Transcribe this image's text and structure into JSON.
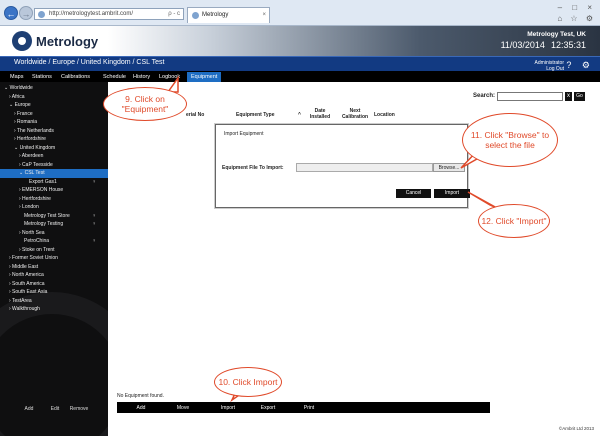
{
  "browser": {
    "url": "http://metrologytest.ambrit.com/",
    "tab_title": "Metrology",
    "addr_tools": "ρ - c",
    "tab_close": "×",
    "window_controls": "–  □  ×",
    "toolbar_icons": "⌂ ☆ ⚙"
  },
  "app": {
    "logo": "Metrology",
    "site_name": "Metrology Test, UK",
    "date": "11/03/2014",
    "time": "12:35:31",
    "breadcrumb": "Worldwide / Europe / United Kingdom / CSL Test",
    "user": "Administrator",
    "logout": "Log Out"
  },
  "menu": {
    "items": [
      "Maps",
      "Stations",
      "Calibrations",
      "Schedule",
      "History",
      "Logbook",
      "Equipment"
    ],
    "active": "Equipment",
    "icons": "? ⚙"
  },
  "sidebar": {
    "tree": [
      {
        "label": "⌄ Worldwide",
        "indent": 0
      },
      {
        "label": "› Africa",
        "indent": 1
      },
      {
        "label": "⌄ Europe",
        "indent": 1
      },
      {
        "label": "› France",
        "indent": 2
      },
      {
        "label": "› Romania",
        "indent": 2
      },
      {
        "label": "› The Netherlands",
        "indent": 2
      },
      {
        "label": "› Hertfordshire",
        "indent": 2
      },
      {
        "label": "⌄ United Kingdom",
        "indent": 2
      },
      {
        "label": "› Aberdeen",
        "indent": 3
      },
      {
        "label": "› CaP Teesside",
        "indent": 3
      },
      {
        "label": "⌄ CSL Test",
        "indent": 3,
        "selected": true
      },
      {
        "label": "Export Gas1",
        "indent": 5,
        "star": "♆"
      },
      {
        "label": "› EMERSON House",
        "indent": 3
      },
      {
        "label": "› Hertfordshire",
        "indent": 3
      },
      {
        "label": "› London",
        "indent": 3
      },
      {
        "label": "Metrology Test Store",
        "indent": 4,
        "star": "♆"
      },
      {
        "label": "Metrology Testing",
        "indent": 4,
        "star": "♆"
      },
      {
        "label": "› North Sea",
        "indent": 3
      },
      {
        "label": "PetroChina",
        "indent": 4,
        "star": "♆"
      },
      {
        "label": "› Stoke on Trent",
        "indent": 3
      },
      {
        "label": "› Former Soviet Union",
        "indent": 1
      },
      {
        "label": "› Middle East",
        "indent": 1
      },
      {
        "label": "› North America",
        "indent": 1
      },
      {
        "label": "› South America",
        "indent": 1
      },
      {
        "label": "› South East Asia",
        "indent": 1
      },
      {
        "label": "› TestArea",
        "indent": 1
      },
      {
        "label": "› Walkthrough",
        "indent": 1
      }
    ],
    "buttons": [
      "Add",
      "Edit",
      "Remove"
    ]
  },
  "main": {
    "search_label": "Search:",
    "search_value": "",
    "search_clear": "x",
    "search_go": "Go",
    "columns": [
      "erial No",
      "Equipment Type",
      "^",
      "Date Installed",
      "Next Calibration",
      "Location"
    ],
    "dialog": {
      "title": "Import Equipment",
      "file_label": "Equipment File To Import:",
      "file_value": "",
      "browse": "Browse...",
      "cancel": "Cancel",
      "import": "Import"
    },
    "empty_text": "No Equipment found.",
    "bottom_buttons": [
      "Add",
      "Move",
      "Import",
      "Export",
      "Print"
    ],
    "footer": "©Ambrit Ltd 2013"
  },
  "callouts": {
    "c9": "9. Click on \"Equipment\"",
    "c10": "10. Click Import",
    "c11": "11. Click \"Browse\" to select the file",
    "c12": "12. Click \"Import\""
  },
  "colors": {
    "callout": "#e04a2a",
    "active_menu": "#1e6dc3",
    "breadcrumb_bg": "#123a82"
  }
}
